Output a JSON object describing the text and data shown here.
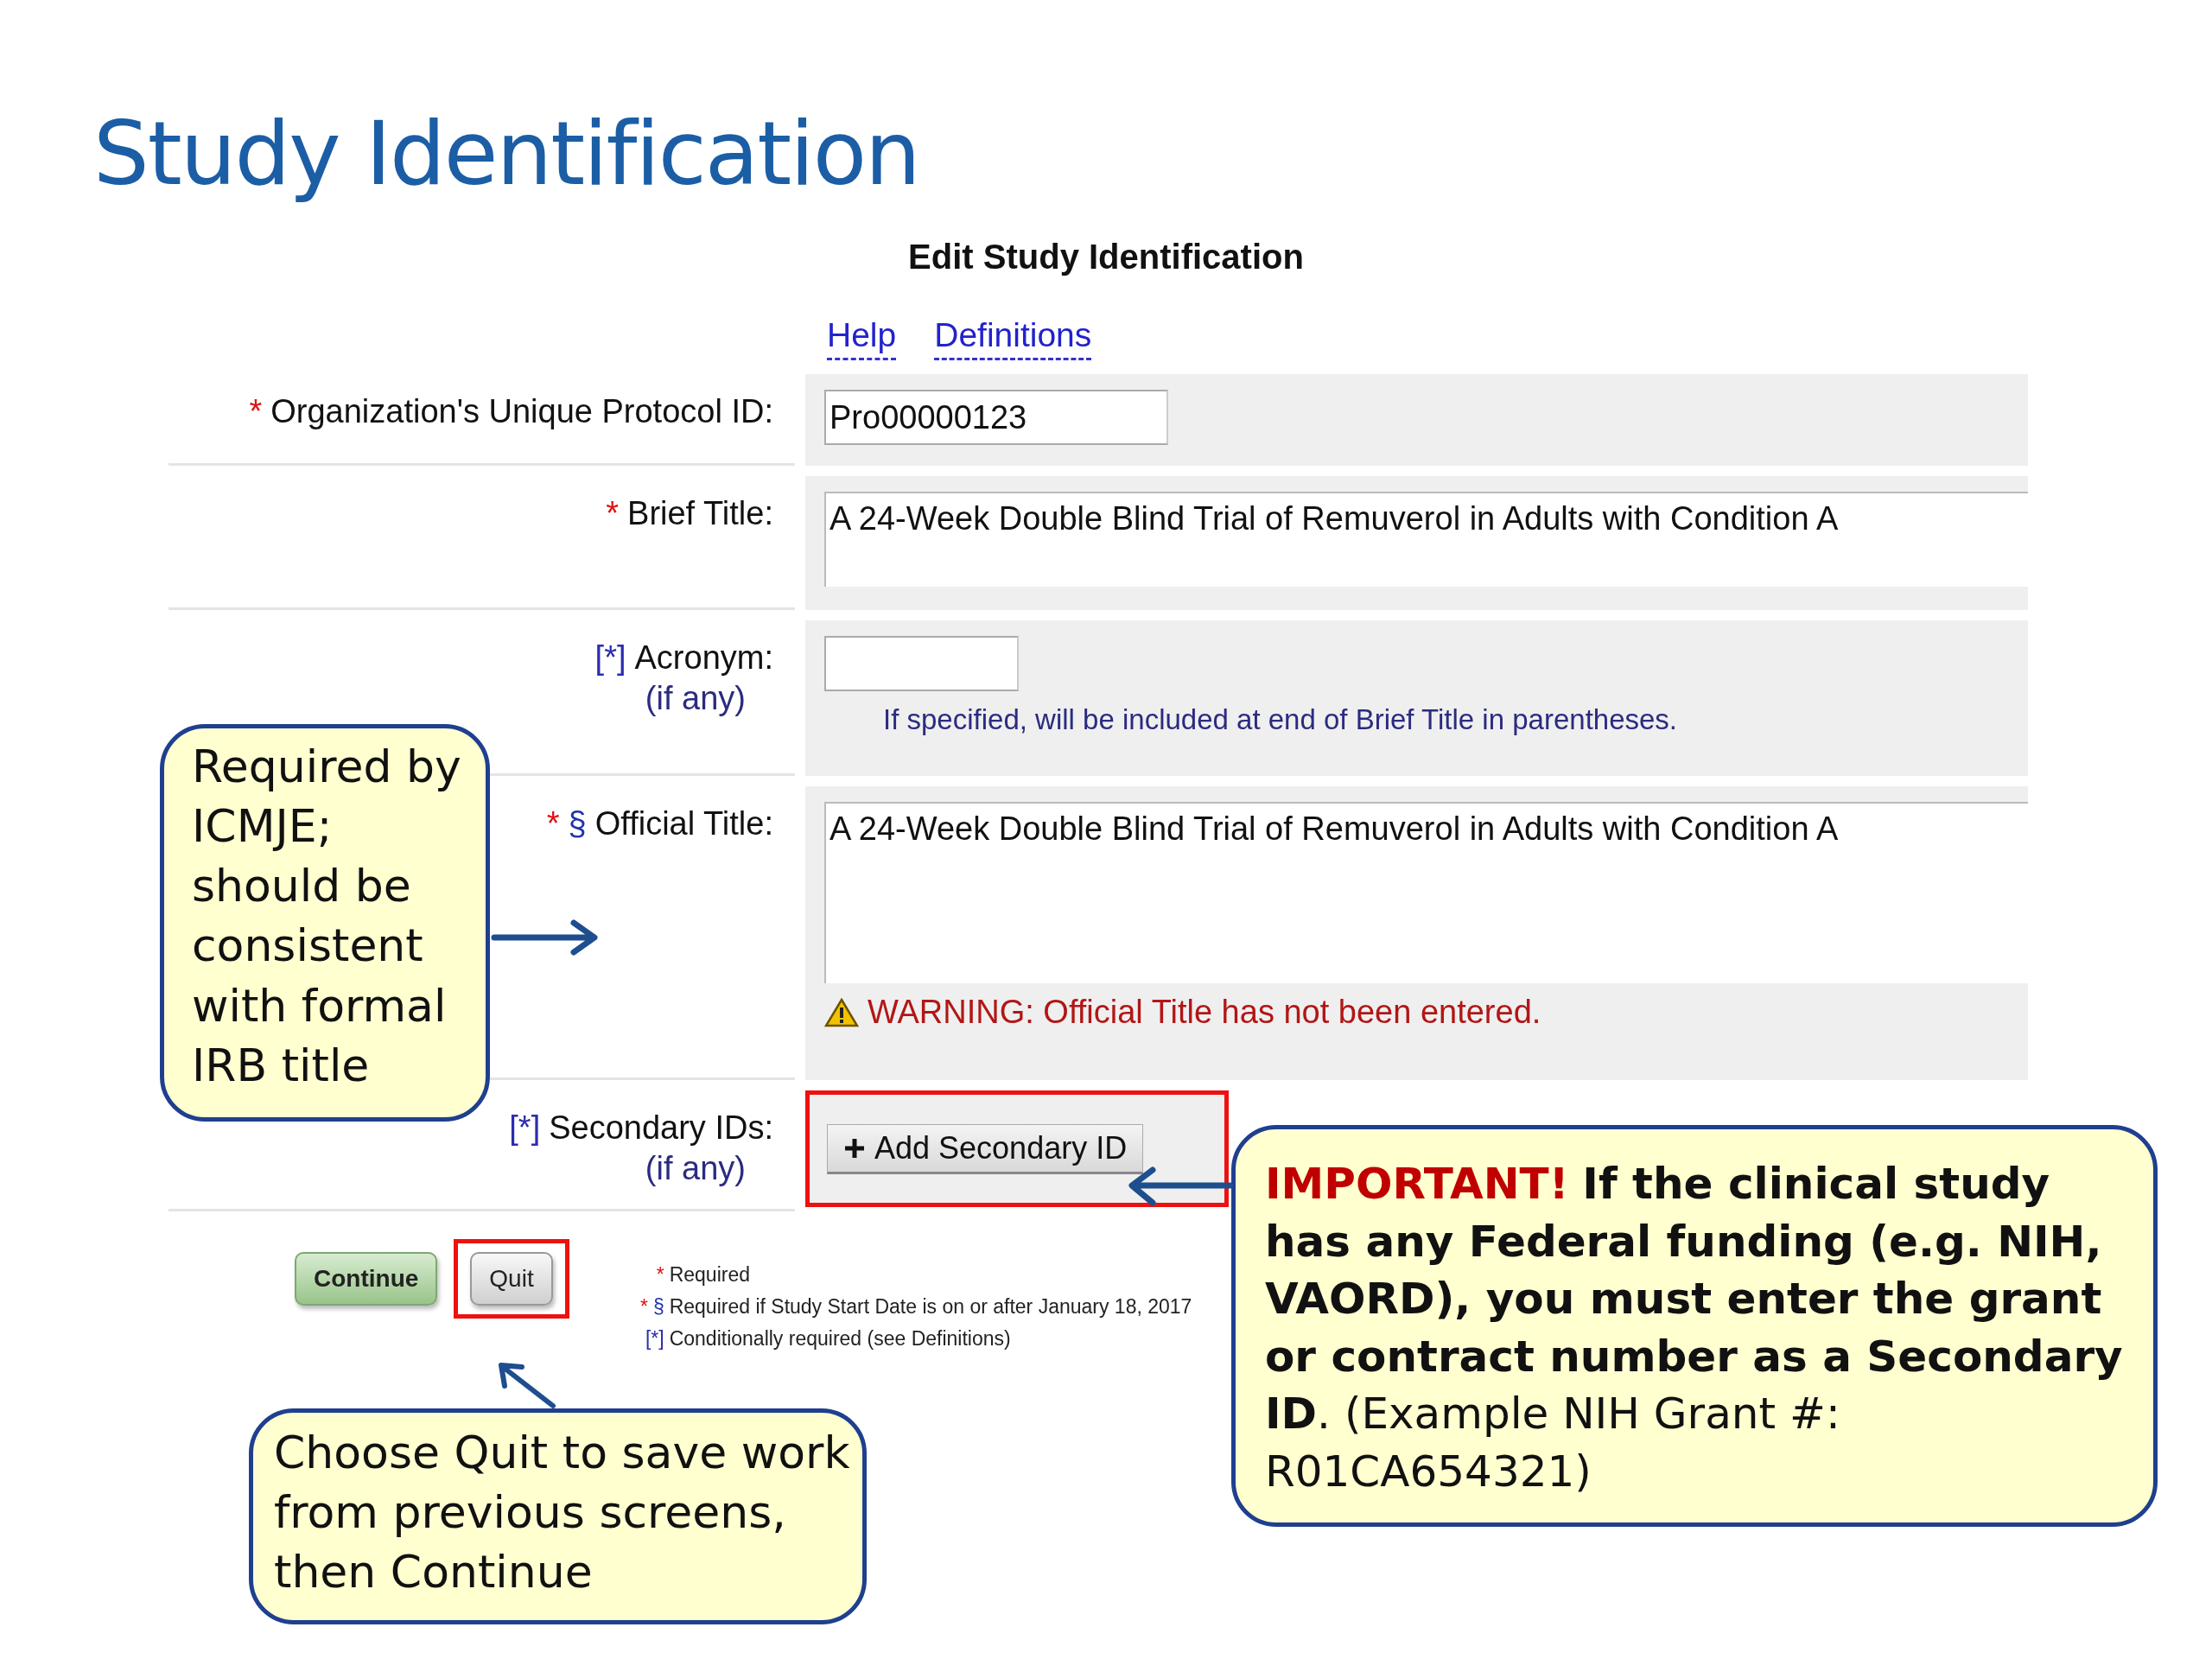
{
  "slide_title": "Study Identification",
  "form": {
    "heading": "Edit Study Identification",
    "links": [
      "Help",
      "Definitions"
    ],
    "fields": [
      {
        "kind": "input",
        "markers": [
          {
            "text": "*",
            "kind": "required"
          }
        ],
        "label": "Organization's Unique Protocol ID:",
        "value": "Pro00000123"
      },
      {
        "kind": "textarea",
        "markers": [
          {
            "text": "*",
            "kind": "required"
          }
        ],
        "label": "Brief Title:",
        "value": "A 24-Week Double Blind Trial of Remuverol in Adults with Condition A"
      },
      {
        "kind": "short-input",
        "markers": [
          {
            "text": "[*]",
            "kind": "conditional"
          }
        ],
        "label": "Acronym:",
        "sublabel": "(if any)",
        "note": "If specified, will be included at end of Brief Title in parentheses."
      },
      {
        "kind": "tall-textarea",
        "markers": [
          {
            "text": "*",
            "kind": "required"
          },
          {
            "text": "§",
            "kind": "dated"
          }
        ],
        "label": "Official Title:",
        "value": "A 24-Week Double Blind Trial of Remuverol in Adults with Condition A",
        "warning": "WARNING: Official Title has not been entered."
      },
      {
        "kind": "add-button",
        "markers": [
          {
            "text": "[*]",
            "kind": "conditional"
          }
        ],
        "label": "Secondary IDs:",
        "sublabel": "(if any)",
        "button": "Add Secondary ID",
        "highlighted": true
      }
    ],
    "buttons": [
      {
        "label": "Continue",
        "kind": "primary",
        "highlighted": false
      },
      {
        "label": "Quit",
        "kind": "secondary",
        "highlighted": true
      }
    ],
    "legend": [
      {
        "markers": [
          {
            "text": "*",
            "kind": "required"
          }
        ],
        "text": "Required"
      },
      {
        "markers": [
          {
            "text": "*",
            "kind": "required"
          },
          {
            "text": "§",
            "kind": "dated"
          }
        ],
        "text": "Required if Study Start Date is on or after January 18, 2017"
      },
      {
        "markers": [
          {
            "text": "[*]",
            "kind": "conditional"
          }
        ],
        "text": "Conditionally required (see Definitions)"
      }
    ]
  },
  "callouts": [
    {
      "kind": "official-title",
      "text": "Required by ICMJE; should be consistent with formal IRB title"
    },
    {
      "kind": "secondary-id",
      "text": "**IMPORTANT!** **If the clinical study has any Federal funding (e.g. NIH, VAORD), you must enter the grant or contract number as a Secondary ID**. (Example NIH Grant #: R01CA654321)"
    },
    {
      "kind": "quit",
      "text": "Choose Quit to save work from previous screens, then Continue"
    }
  ]
}
